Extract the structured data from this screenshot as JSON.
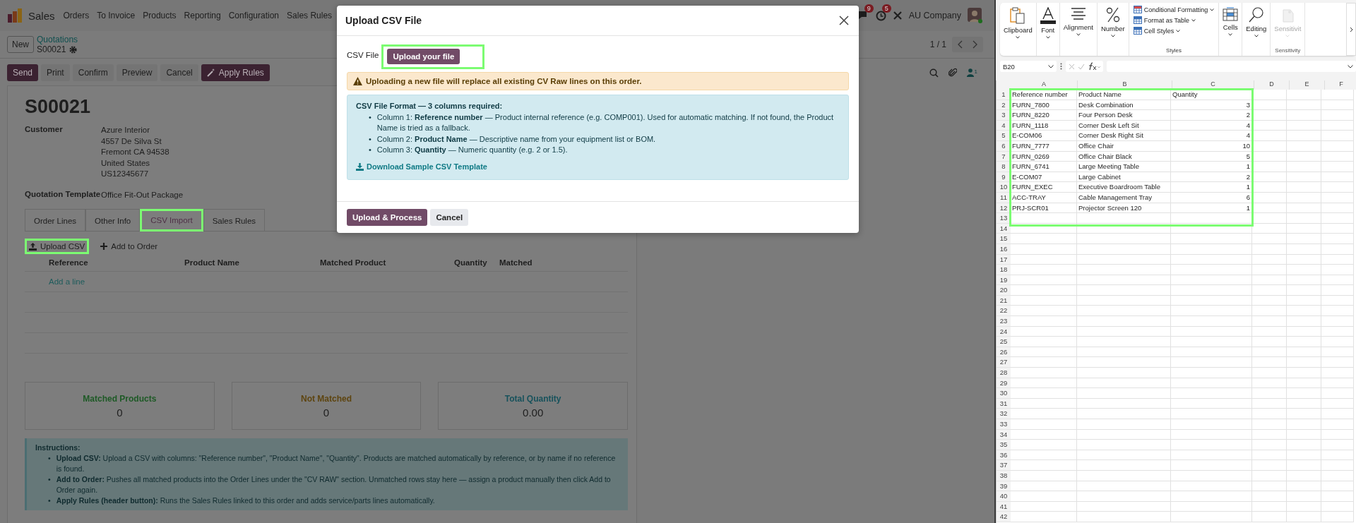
{
  "app_nav": {
    "app_name": "Sales",
    "menu": [
      "Orders",
      "To Invoice",
      "Products",
      "Reporting",
      "Configuration",
      "Sales Rules"
    ],
    "messages_badge": "9",
    "activities_badge": "5",
    "company": "AU Company"
  },
  "control_panel": {
    "new_button": "New",
    "breadcrumb": "Quotations",
    "record": "S00021",
    "pager": "1 / 1"
  },
  "action_buttons": [
    {
      "label": "Send",
      "kind": "primary"
    },
    {
      "label": "Print",
      "kind": "secondary"
    },
    {
      "label": "Confirm",
      "kind": "secondary"
    },
    {
      "label": "Preview",
      "kind": "secondary"
    },
    {
      "label": "Cancel",
      "kind": "secondary"
    },
    {
      "label": "Apply Rules",
      "kind": "magic"
    }
  ],
  "chatter": {
    "followers_count": "1"
  },
  "form": {
    "title": "S00021",
    "customer_label": "Customer",
    "customer_lines": [
      "Azure Interior",
      "4557 De Silva St",
      "Fremont CA 94538",
      "United States",
      "US12345677"
    ],
    "template_label": "Quotation Template",
    "template": "Office Fit-Out Package",
    "tabs": [
      {
        "label": "Order Lines",
        "selected": false,
        "highlighted": false
      },
      {
        "label": "Other Info",
        "selected": false,
        "highlighted": false
      },
      {
        "label": "CSV Import",
        "selected": true,
        "highlighted": true
      },
      {
        "label": "Sales Rules",
        "selected": false,
        "highlighted": false
      }
    ],
    "list_actions": [
      {
        "label": "Upload CSV",
        "kind": "upload",
        "highlighted": true
      },
      {
        "label": "Add to Order",
        "kind": "add",
        "highlighted": false
      }
    ],
    "table": {
      "columns": [
        "Reference",
        "Product Name",
        "Matched Product",
        "Quantity",
        "Matched"
      ],
      "add_line": "Add a line"
    },
    "stats": [
      {
        "label": "Matched Products",
        "value": "0",
        "color": "#1e5a26"
      },
      {
        "label": "Not Matched",
        "value": "0",
        "color": "#5e4510"
      },
      {
        "label": "Total Quantity",
        "value": "0.00",
        "color": "#17525c"
      }
    ],
    "instructions": {
      "title": "Instructions:",
      "bullet": "•",
      "items": [
        "**Upload CSV:** Upload a CSV with columns: \"Reference number\", \"Product Name\", \"Quantity\". Products are matched automatically by reference, or by name if no reference is found.",
        "**Add to Order:** Pushes all matched products into the Order Lines under the \"CV RAW\" section. Unmatched rows stay here — assign a product manually then click Add to Order again.",
        "**Apply Rules (header button):** Runs the Sales Rules linked to this order and adds service/parts lines automatically."
      ]
    }
  },
  "modal": {
    "title": "Upload CSV File",
    "file_label": "CSV File",
    "file_button": {
      "label": "Upload your file",
      "highlighted": true
    },
    "warning": "Uploading a new file will replace all existing CV Raw lines on this order.",
    "format_title": "CSV File Format — 3 columns required:",
    "bullet": "•",
    "format_items": [
      "Column 1: **Reference number** — Product internal reference (e.g. COMP001). Used for automatic matching. If not found, the Product Name is tried as a fallback.",
      "Column 2: **Product Name** — Descriptive name from your equipment list or BOM.",
      "Column 3: **Quantity** — Numeric quantity (e.g. 2 or 1.5)."
    ],
    "download_link": "Download Sample CSV Template",
    "buttons": [
      {
        "label": "Upload & Process",
        "kind": "primary"
      },
      {
        "label": "Cancel",
        "kind": "secondary"
      }
    ]
  },
  "excel": {
    "ribbon_groups": [
      {
        "kind": "clipboard",
        "label": "Clipboard",
        "disabled": false
      },
      {
        "kind": "font",
        "label": "Font",
        "disabled": false
      },
      {
        "kind": "alignment",
        "label": "Alignment",
        "disabled": false
      },
      {
        "kind": "number",
        "label": "Number",
        "disabled": false
      },
      {
        "kind": "styles",
        "label": "Styles",
        "items": [
          "Conditional Formatting",
          "Format as Table",
          "Cell Styles"
        ],
        "disabled": false
      },
      {
        "kind": "cells",
        "label": "Cells",
        "disabled": false
      },
      {
        "kind": "editing",
        "label": "Editing",
        "disabled": false
      },
      {
        "kind": "sensitivity",
        "label": "Sensitivit",
        "group_label": "Sensitivity",
        "disabled": true
      }
    ],
    "name_box": "B20",
    "columns": [
      "A",
      "B",
      "C",
      "D",
      "E",
      "F"
    ],
    "range_highlighted": true,
    "rows": [
      {
        "number": "1",
        "cells": [
          "Reference number",
          "Product Name",
          "Quantity"
        ]
      },
      {
        "number": "2",
        "cells": [
          "FURN_7800",
          "Desk Combination",
          "3"
        ]
      },
      {
        "number": "3",
        "cells": [
          "FURN_8220",
          "Four Person Desk",
          "2"
        ]
      },
      {
        "number": "4",
        "cells": [
          "FURN_1118",
          "Corner Desk Left Sit",
          "4"
        ]
      },
      {
        "number": "5",
        "cells": [
          "E-COM06",
          "Corner Desk Right Sit",
          "4"
        ]
      },
      {
        "number": "6",
        "cells": [
          "FURN_7777",
          "Office Chair",
          "10"
        ]
      },
      {
        "number": "7",
        "cells": [
          "FURN_0269",
          "Office Chair Black",
          "5"
        ]
      },
      {
        "number": "8",
        "cells": [
          "FURN_6741",
          "Large Meeting Table",
          "1"
        ]
      },
      {
        "number": "9",
        "cells": [
          "E-COM07",
          "Large Cabinet",
          "2"
        ]
      },
      {
        "number": "10",
        "cells": [
          "FURN_EXEC",
          "Executive Boardroom Table",
          "1"
        ]
      },
      {
        "number": "11",
        "cells": [
          "ACC-TRAY",
          "Cable Management Tray",
          "6"
        ]
      },
      {
        "number": "12",
        "cells": [
          "PRJ-SCR01",
          "Projector Screen 120",
          "1"
        ]
      },
      {
        "number": "13"
      },
      {
        "number": "14"
      },
      {
        "number": "15"
      },
      {
        "number": "16"
      },
      {
        "number": "17"
      },
      {
        "number": "18"
      },
      {
        "number": "19"
      },
      {
        "number": "20"
      },
      {
        "number": "21"
      },
      {
        "number": "22"
      },
      {
        "number": "23"
      },
      {
        "number": "24"
      },
      {
        "number": "25"
      },
      {
        "number": "26"
      },
      {
        "number": "27"
      },
      {
        "number": "28"
      },
      {
        "number": "29"
      },
      {
        "number": "30"
      },
      {
        "number": "31"
      },
      {
        "number": "32"
      },
      {
        "number": "33"
      },
      {
        "number": "34"
      },
      {
        "number": "35"
      },
      {
        "number": "36"
      },
      {
        "number": "37"
      },
      {
        "number": "38"
      },
      {
        "number": "39"
      },
      {
        "number": "40"
      },
      {
        "number": "41"
      },
      {
        "number": "42"
      }
    ]
  }
}
